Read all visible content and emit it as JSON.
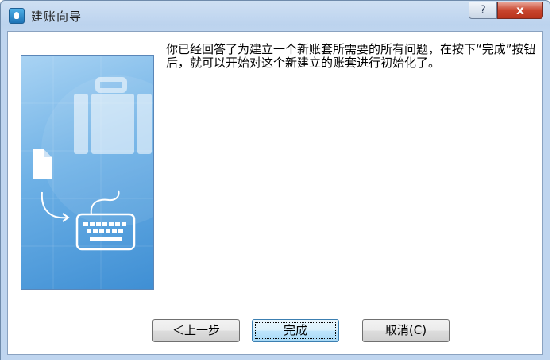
{
  "window": {
    "title": "建账向导",
    "help_label": "?",
    "close_label": "x"
  },
  "wizard": {
    "message": "你已经回答了为建立一个新账套所需要的所有问题，在按下“完成”按钮后，就可以开始对这个新建立的账套进行初始化了。"
  },
  "buttons": {
    "back_label": "＜上一步",
    "finish_label": "完成",
    "cancel_label": "取消(C)"
  },
  "icons": {
    "app": "wizard-app-icon",
    "side_art": [
      "briefcase-icon",
      "document-icon",
      "arrow-icon",
      "keyboard-icon"
    ]
  },
  "colors": {
    "title_bar": "#bcd3ee",
    "close_button": "#c9462f",
    "art_panel": "#6eb1e6",
    "default_button": "#bee6fd"
  }
}
